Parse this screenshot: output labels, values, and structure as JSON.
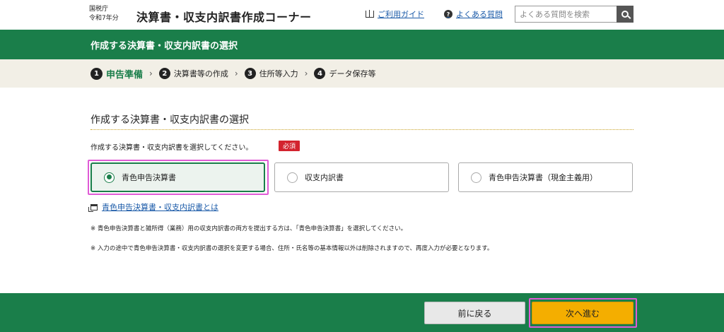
{
  "header": {
    "agency": "国税庁",
    "year": "令和7年分",
    "site_title": "決算書・収支内訳書作成コーナー",
    "guide_link": "ご利用ガイド",
    "faq_link": "よくある質問",
    "search_placeholder": "よくある質問を検索"
  },
  "title_bar": {
    "title": "作成する決算書・収支内訳書の選択"
  },
  "steps": [
    {
      "num": "1",
      "label": "申告準備",
      "current": true
    },
    {
      "num": "2",
      "label": "決算書等の作成",
      "current": false
    },
    {
      "num": "3",
      "label": "住所等入力",
      "current": false
    },
    {
      "num": "4",
      "label": "データ保存等",
      "current": false
    }
  ],
  "main": {
    "section_title": "作成する決算書・収支内訳書の選択",
    "instruction": "作成する決算書・収支内訳書を選択してください。",
    "required_badge": "必須",
    "options": [
      {
        "label": "青色申告決算書",
        "selected": true
      },
      {
        "label": "収支内訳書",
        "selected": false
      },
      {
        "label": "青色申告決算書（現金主義用）",
        "selected": false
      }
    ],
    "help_link": "青色申告決算書・収支内訳書とは",
    "notes": [
      "※ 青色申告決算書と雑所得（業務）用の収支内訳書の両方を提出する方は、「青色申告決算書」を選択してください。",
      "※ 入力の途中で青色申告決算書・収支内訳書の選択を変更する場合、住所・氏名等の基本情報以外は削除されますので、再度入力が必要となります。"
    ]
  },
  "footer": {
    "back_label": "前に戻る",
    "next_label": "次へ進む"
  },
  "colors": {
    "brand_green": "#1a7e4a",
    "next_button": "#f4ae00",
    "required_red": "#d3232e",
    "highlight": "#e05bd6"
  }
}
